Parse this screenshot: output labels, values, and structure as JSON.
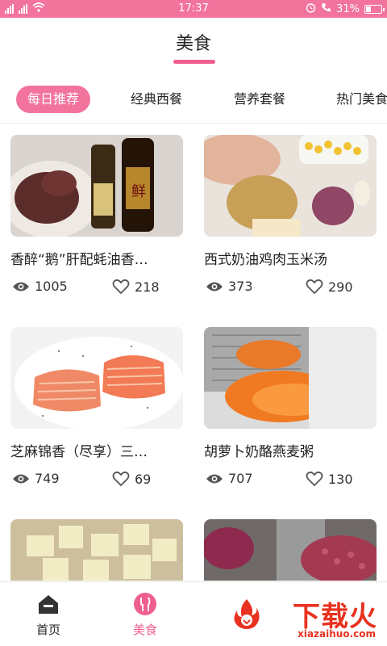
{
  "status_bar": {
    "left": "4G 4G",
    "time": "17:37",
    "battery": "31%",
    "battery_level": 0.31
  },
  "header": {
    "title": "美食"
  },
  "tabs": [
    {
      "label": "每日推荐",
      "active": true
    },
    {
      "label": "经典西餐",
      "active": false
    },
    {
      "label": "营养套餐",
      "active": false
    },
    {
      "label": "热门美食",
      "active": false
    }
  ],
  "cards": [
    {
      "title": "香醉“鹅”肝配蚝油香…",
      "views": "1005",
      "likes": "218",
      "image": "goose liver with oyster sauce bottles"
    },
    {
      "title": "西式奶油鸡肉玉米汤",
      "views": "373",
      "likes": "290",
      "image": "chicken breast, corn, potato, onion"
    },
    {
      "title": "芝麻锦香（尽享）三…",
      "views": "749",
      "likes": "69",
      "image": "salmon fillets with sesame"
    },
    {
      "title": "胡萝卜奶酪燕麦粥",
      "views": "707",
      "likes": "130",
      "image": "grated carrot on grater"
    },
    {
      "title": "",
      "views": "",
      "likes": "",
      "image": "diced potatoes"
    },
    {
      "title": "",
      "views": "",
      "likes": "",
      "image": "red onion and minced meat"
    }
  ],
  "bottom_nav": [
    {
      "label": "首页",
      "icon": "home-icon",
      "active": false
    },
    {
      "label": "美食",
      "icon": "fork-knife-icon",
      "active": true
    }
  ],
  "watermark": {
    "cn": "下载火",
    "en": "xiazaihuo.com"
  },
  "colors": {
    "accent": "#f2749d",
    "accent_dark": "#ee5f8d",
    "watermark": "#e8321f"
  }
}
